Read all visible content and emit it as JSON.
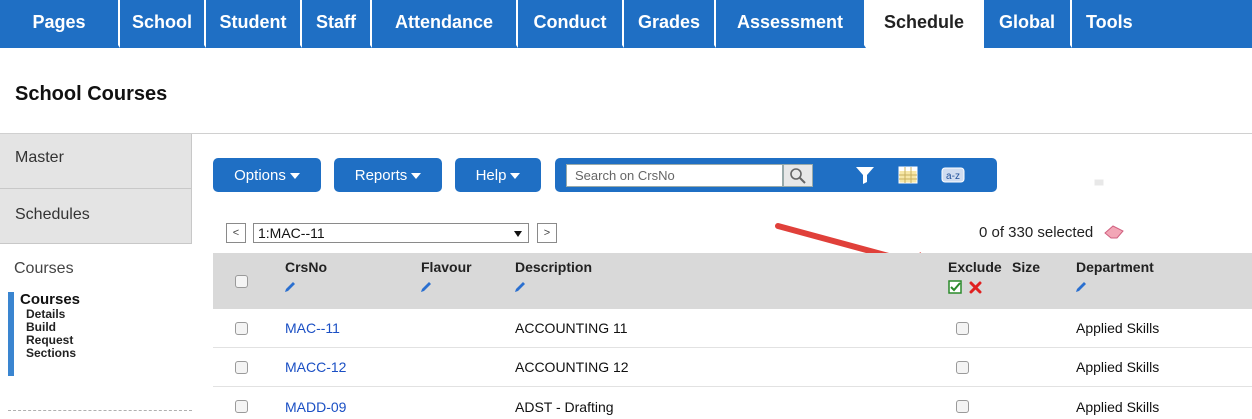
{
  "nav": {
    "tabs": [
      {
        "label": "Pages"
      },
      {
        "label": "School"
      },
      {
        "label": "Student"
      },
      {
        "label": "Staff"
      },
      {
        "label": "Attendance"
      },
      {
        "label": "Conduct"
      },
      {
        "label": "Grades"
      },
      {
        "label": "Assessment"
      },
      {
        "label": "Schedule",
        "active": true
      },
      {
        "label": "Global"
      },
      {
        "label": "Tools"
      }
    ]
  },
  "page_title": "School Courses",
  "sidebar": {
    "tabs": [
      "Master",
      "Schedules"
    ],
    "current": "Courses",
    "sub": {
      "title": "Courses",
      "items": [
        "Details",
        "Build",
        "Request",
        "Sections"
      ]
    }
  },
  "toolbar": {
    "options_label": "Options",
    "reports_label": "Reports",
    "help_label": "Help",
    "search_placeholder": "Search on CrsNo",
    "icons": [
      "search-icon",
      "filter-icon",
      "grid-icon",
      "sort-az-icon",
      "chart-icon",
      "print-icon"
    ]
  },
  "pager": {
    "prev": "<",
    "next": ">",
    "selected": "1:MAC--11",
    "selection_text": "0 of 330 selected"
  },
  "table": {
    "columns": [
      "CrsNo",
      "Flavour",
      "Description",
      "Exclude",
      "Size",
      "Department"
    ],
    "rows": [
      {
        "crsno": "MAC--11",
        "flavour": "",
        "description": "ACCOUNTING 11",
        "department": "Applied Skills"
      },
      {
        "crsno": "MACC-12",
        "flavour": "",
        "description": "ACCOUNTING 12",
        "department": "Applied Skills"
      },
      {
        "crsno": "MADD-09",
        "flavour": "",
        "description": "ADST - Drafting",
        "department": "Applied Skills"
      }
    ]
  },
  "colors": {
    "accent": "#1f6fc4",
    "link": "#1a4fc4",
    "annotation_arrow": "#e0403a"
  }
}
